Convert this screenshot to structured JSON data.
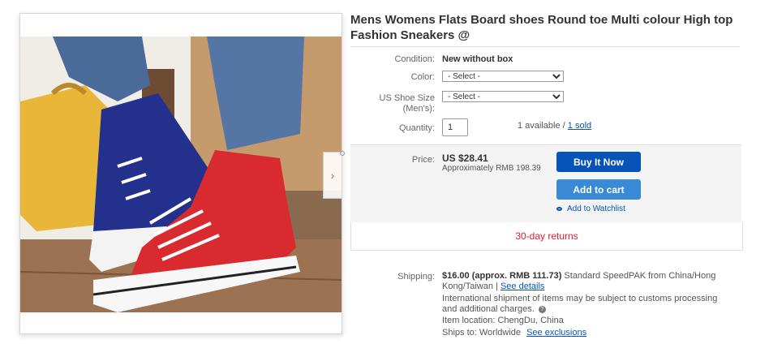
{
  "product": {
    "title": "Mens Womens Flats Board shoes Round toe Multi colour High top Fashion Sneakers @"
  },
  "fields": {
    "condition_label": "Condition:",
    "condition_value": "New without box",
    "color_label": "Color:",
    "color_selected": "- Select -",
    "size_label": "US Shoe Size (Men's):",
    "size_selected": "- Select -",
    "quantity_label": "Quantity:",
    "quantity_value": "1",
    "availability": "1 available /",
    "sold_link": "1 sold"
  },
  "pricing": {
    "price_label": "Price:",
    "price": "US $28.41",
    "approx": "Approximately RMB 198.39",
    "buy_button": "Buy It Now",
    "cart_button": "Add to cart",
    "watchlist": "Add to Watchlist",
    "returns": "30-day returns"
  },
  "shipping": {
    "label": "Shipping:",
    "cost": "$16.00 (approx. RMB 111.73)",
    "method": "Standard SpeedPAK from China/Hong Kong/Taiwan |",
    "details_link": "See details",
    "notice": "International shipment of items may be subject to customs processing and additional charges.",
    "location": "Item location:  ChengDu, China",
    "ships_to": "Ships to:  Worldwide",
    "exclusions_link": "See exclusions"
  },
  "gallery": {
    "next_arrow": "›"
  },
  "colors": {
    "buy_button": "#0654ba",
    "cart_button": "#3a8ad6",
    "returns_text": "#dd1e31",
    "link": "#0654ba"
  }
}
